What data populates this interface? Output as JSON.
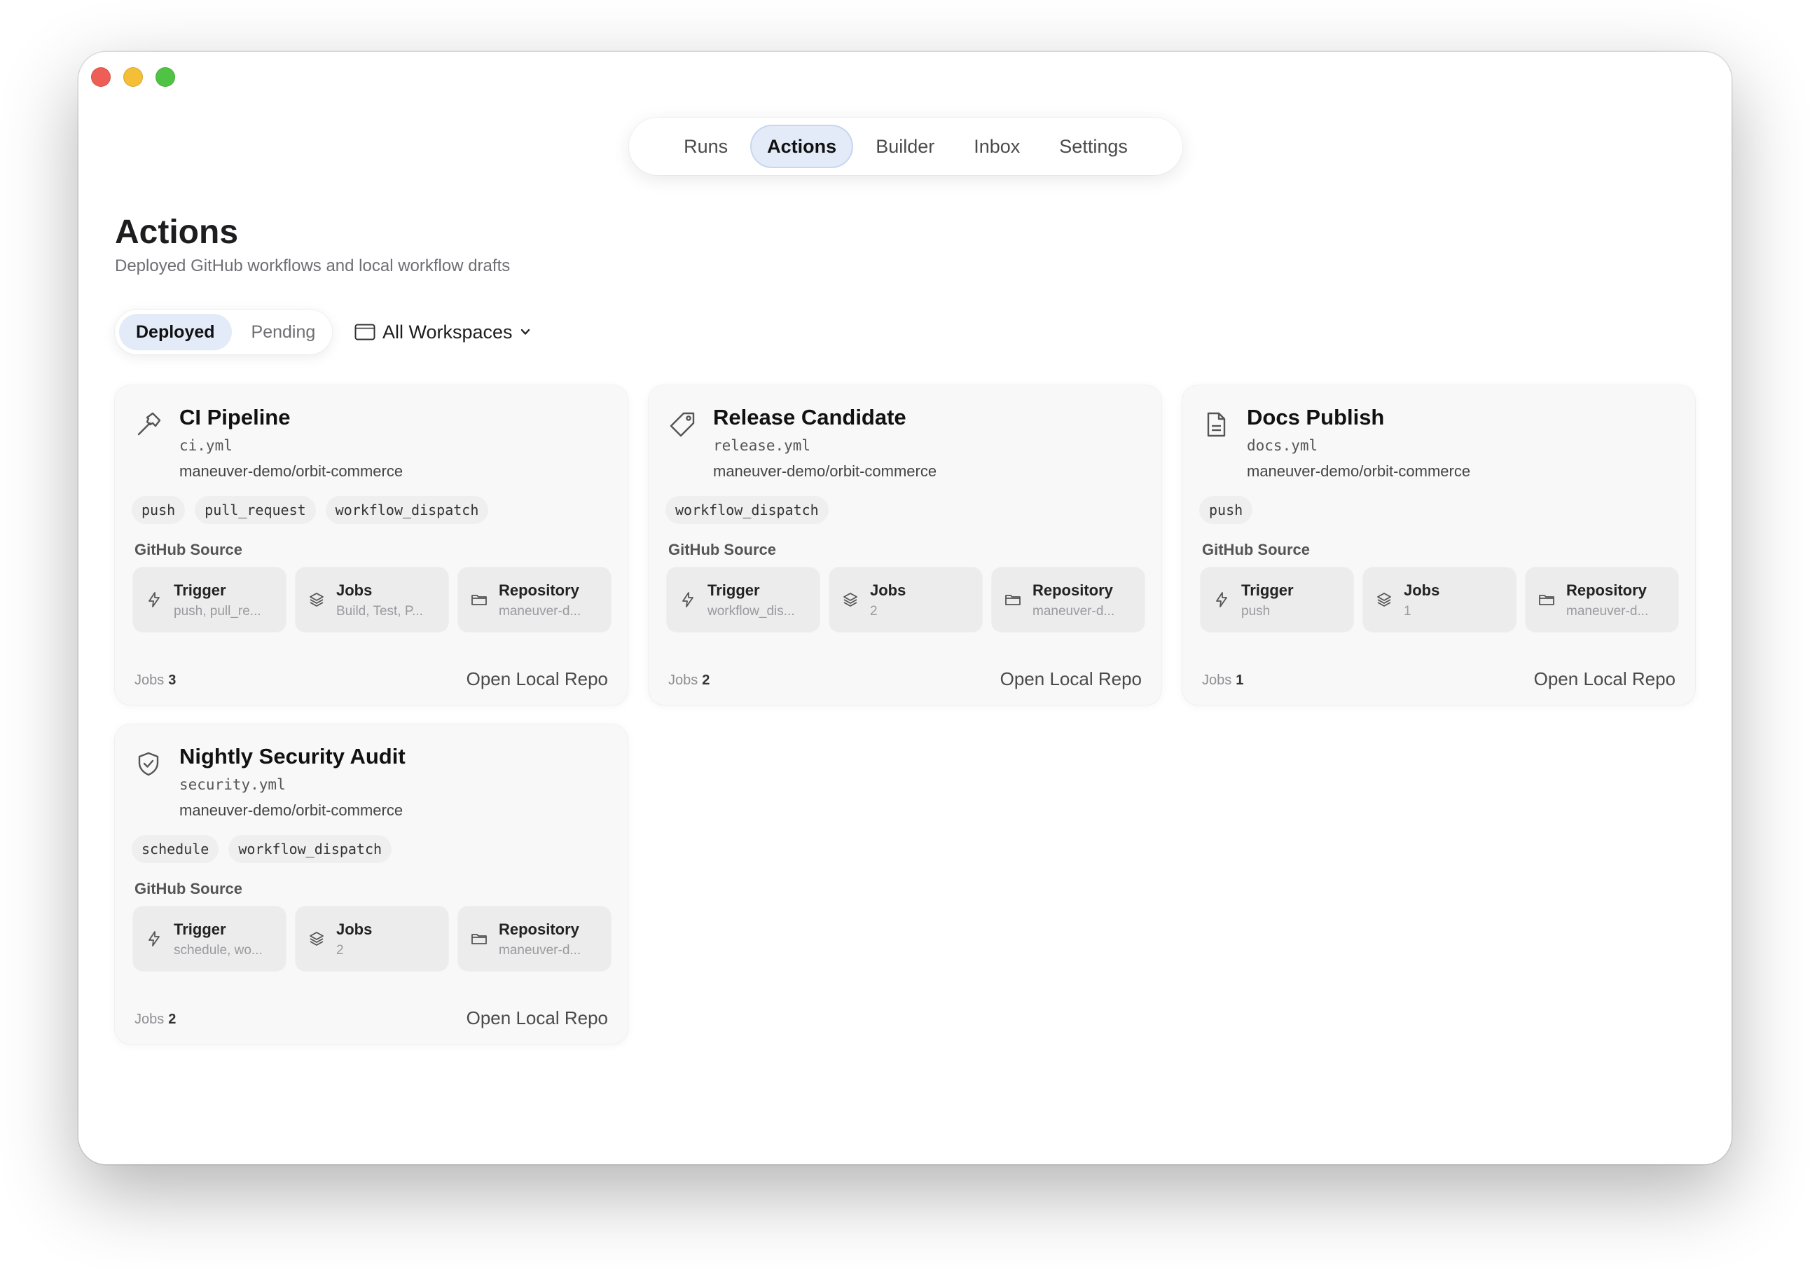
{
  "nav": {
    "tabs": [
      {
        "label": "Runs",
        "active": false
      },
      {
        "label": "Actions",
        "active": true
      },
      {
        "label": "Builder",
        "active": false
      },
      {
        "label": "Inbox",
        "active": false
      },
      {
        "label": "Settings",
        "active": false
      }
    ]
  },
  "header": {
    "title": "Actions",
    "subtitle": "Deployed GitHub workflows and local workflow drafts"
  },
  "filter": {
    "segments": [
      {
        "label": "Deployed",
        "active": true
      },
      {
        "label": "Pending",
        "active": false
      }
    ],
    "workspace_label": "All Workspaces"
  },
  "colors": {
    "accent_bg": "#e3ebf9",
    "card_bg": "#f8f8f8",
    "tile_bg": "#ececec"
  },
  "cards": [
    {
      "icon": "hammer-icon",
      "title": "CI Pipeline",
      "file": "ci.yml",
      "repo": "maneuver-demo/orbit-commerce",
      "triggers": [
        "push",
        "pull_request",
        "workflow_dispatch"
      ],
      "source_label": "GitHub Source",
      "tiles": [
        {
          "label": "Trigger",
          "value": "push, pull_re...",
          "icon": "bolt-icon"
        },
        {
          "label": "Jobs",
          "value": "Build, Test, P...",
          "icon": "layers-icon"
        },
        {
          "label": "Repository",
          "value": "maneuver-d...",
          "icon": "folder-icon"
        }
      ],
      "jobs_label": "Jobs",
      "jobs_count": "3",
      "open_label": "Open Local Repo"
    },
    {
      "icon": "tag-icon",
      "title": "Release Candidate",
      "file": "release.yml",
      "repo": "maneuver-demo/orbit-commerce",
      "triggers": [
        "workflow_dispatch"
      ],
      "source_label": "GitHub Source",
      "tiles": [
        {
          "label": "Trigger",
          "value": "workflow_dis...",
          "icon": "bolt-icon"
        },
        {
          "label": "Jobs",
          "value": "2",
          "icon": "layers-icon"
        },
        {
          "label": "Repository",
          "value": "maneuver-d...",
          "icon": "folder-icon"
        }
      ],
      "jobs_label": "Jobs",
      "jobs_count": "2",
      "open_label": "Open Local Repo"
    },
    {
      "icon": "document-icon",
      "title": "Docs Publish",
      "file": "docs.yml",
      "repo": "maneuver-demo/orbit-commerce",
      "triggers": [
        "push"
      ],
      "source_label": "GitHub Source",
      "tiles": [
        {
          "label": "Trigger",
          "value": "push",
          "icon": "bolt-icon"
        },
        {
          "label": "Jobs",
          "value": "1",
          "icon": "layers-icon"
        },
        {
          "label": "Repository",
          "value": "maneuver-d...",
          "icon": "folder-icon"
        }
      ],
      "jobs_label": "Jobs",
      "jobs_count": "1",
      "open_label": "Open Local Repo"
    },
    {
      "icon": "shield-check-icon",
      "title": "Nightly Security Audit",
      "file": "security.yml",
      "repo": "maneuver-demo/orbit-commerce",
      "triggers": [
        "schedule",
        "workflow_dispatch"
      ],
      "source_label": "GitHub Source",
      "tiles": [
        {
          "label": "Trigger",
          "value": "schedule, wo...",
          "icon": "bolt-icon"
        },
        {
          "label": "Jobs",
          "value": "2",
          "icon": "layers-icon"
        },
        {
          "label": "Repository",
          "value": "maneuver-d...",
          "icon": "folder-icon"
        }
      ],
      "jobs_label": "Jobs",
      "jobs_count": "2",
      "open_label": "Open Local Repo"
    }
  ]
}
